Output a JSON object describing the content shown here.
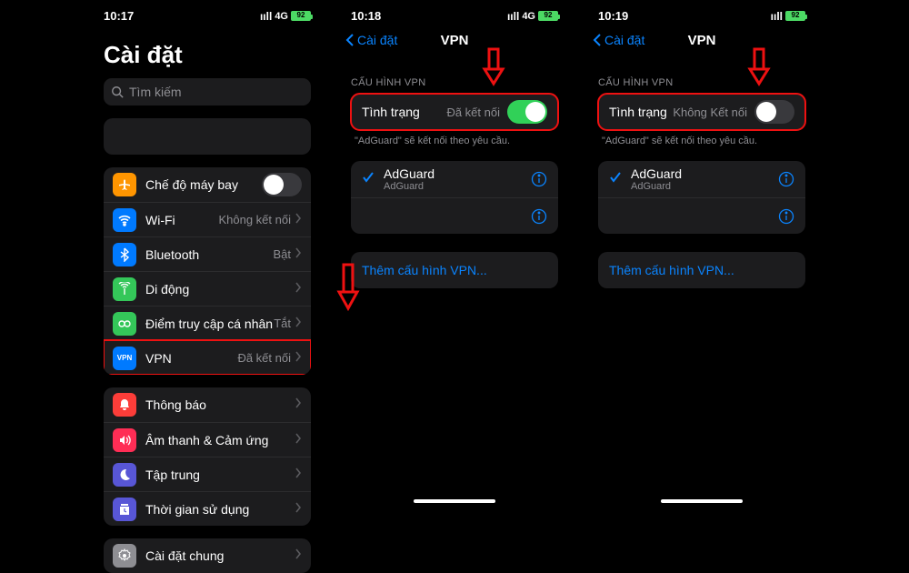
{
  "phone1": {
    "time": "10:17",
    "signal": "4G",
    "battery": "92",
    "title": "Cài đặt",
    "search_placeholder": "Tìm kiếm",
    "rows": {
      "airplane": "Chế độ máy bay",
      "wifi": "Wi-Fi",
      "wifi_detail": "Không kết nối",
      "bluetooth": "Bluetooth",
      "bluetooth_detail": "Bật",
      "cellular": "Di động",
      "hotspot": "Điểm truy cập cá nhân",
      "hotspot_detail": "Tắt",
      "vpn": "VPN",
      "vpn_detail": "Đã kết nối",
      "notif": "Thông báo",
      "sound": "Âm thanh & Cảm ứng",
      "focus": "Tập trung",
      "screentime": "Thời gian sử dụng",
      "general": "Cài đặt chung"
    }
  },
  "phone2": {
    "time": "10:18",
    "signal": "4G",
    "battery": "92",
    "back": "Cài đặt",
    "nav_title": "VPN",
    "section": "CẤU HÌNH VPN",
    "status_label": "Tình trạng",
    "status_value": "Đã kết nối",
    "status_on": true,
    "footnote": "\"AdGuard\" sẽ kết nối theo yêu cầu.",
    "adguard": "AdGuard",
    "adguard_sub": "AdGuard",
    "add": "Thêm cấu hình VPN..."
  },
  "phone3": {
    "time": "10:19",
    "signal": "",
    "battery": "92",
    "back": "Cài đặt",
    "nav_title": "VPN",
    "section": "CẤU HÌNH VPN",
    "status_label": "Tình trạng",
    "status_value": "Không Kết nối",
    "status_on": false,
    "footnote": "\"AdGuard\" sẽ kết nối theo yêu cầu.",
    "adguard": "AdGuard",
    "adguard_sub": "AdGuard",
    "add": "Thêm cấu hình VPN..."
  }
}
